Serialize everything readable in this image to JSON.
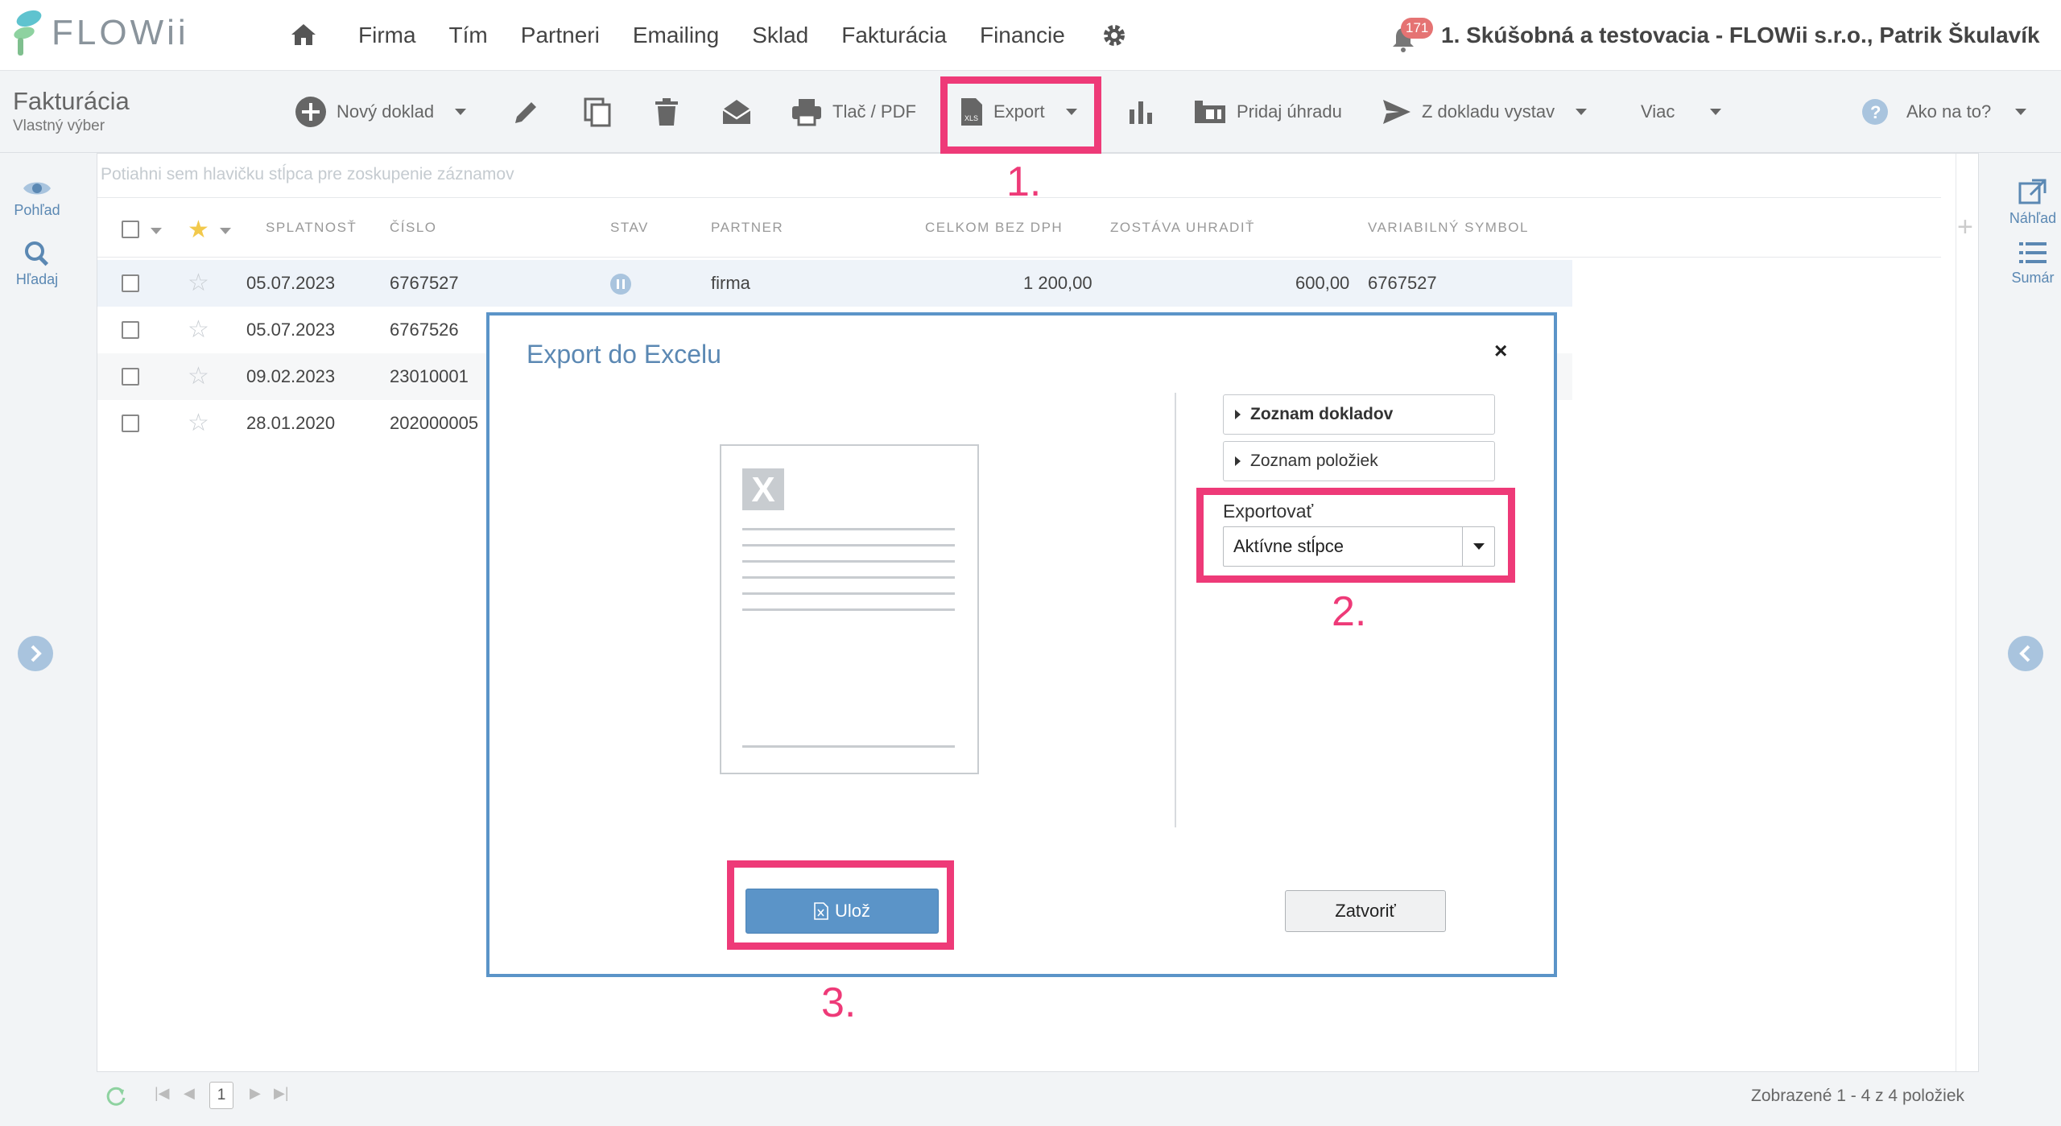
{
  "app": {
    "logo_text": "FLOWii",
    "nav": [
      "Firma",
      "Tím",
      "Partneri",
      "Emailing",
      "Sklad",
      "Fakturácia",
      "Financie"
    ],
    "notification_count": "171",
    "user_info": "1. Skúšobná a testovacia - FLOWii s.r.o., Patrik Škulavík"
  },
  "toolbar": {
    "page_title": "Fakturácia",
    "page_subtitle": "Vlastný výber",
    "new_doc": "Nový doklad",
    "print": "Tlač / PDF",
    "export": "Export",
    "add_payment": "Pridaj úhradu",
    "issue_from": "Z dokladu vystav",
    "more": "Viac",
    "help": "Ako na to?"
  },
  "sidebar": {
    "left": [
      "Pohľad",
      "Hľadaj"
    ],
    "right": [
      "Náhľad",
      "Sumár"
    ]
  },
  "grid": {
    "group_hint": "Potiahni sem hlavičku stĺpca pre zoskupenie záznamov",
    "columns": [
      "SPLATNOSŤ",
      "ČÍSLO",
      "STAV",
      "PARTNER",
      "CELKOM BEZ DPH",
      "ZOSTÁVA UHRADIŤ",
      "VARIABILNÝ SYMBOL"
    ],
    "rows": [
      {
        "due": "05.07.2023",
        "number": "6767527",
        "partner": "firma",
        "total": "1 200,00",
        "remaining": "600,00",
        "vs": "6767527"
      },
      {
        "due": "05.07.2023",
        "number": "6767526"
      },
      {
        "due": "09.02.2023",
        "number": "23010001"
      },
      {
        "due": "28.01.2020",
        "number": "202000005"
      }
    ],
    "current_page": "1",
    "footer_info": "Zobrazené 1 - 4 z 4 položiek"
  },
  "dialog": {
    "title": "Export do Excelu",
    "close_symbol": "×",
    "section_documents": "Zoznam dokladov",
    "section_items": "Zoznam položiek",
    "export_label": "Exportovať",
    "export_value": "Aktívne stĺpce",
    "save_label": "Ulož",
    "close_label": "Zatvoriť"
  },
  "annotations": [
    "1.",
    "2.",
    "3."
  ],
  "colors": {
    "accent": "#5b94c8",
    "annotation": "#ee3a78",
    "badge": "#e57373"
  }
}
